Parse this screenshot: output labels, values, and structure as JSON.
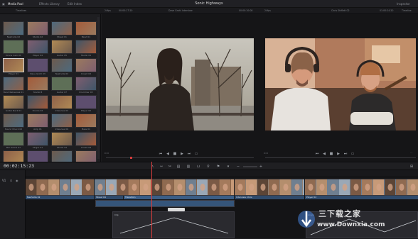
{
  "topbar": {
    "tabs": [
      {
        "label": "Media Pool",
        "active": true
      },
      {
        "label": "Effects Library",
        "active": false
      },
      {
        "label": "Edit Index",
        "active": false
      }
    ],
    "title": "Sonic Highways",
    "right_tab": "Inspector"
  },
  "subbar": {
    "left": "Timelines",
    "src_fps": "24fps",
    "src_tc": "00:00:17:20",
    "src_clip": "Dave Grohl Interview",
    "src_dur": "00:00:10:08",
    "rec_fps": "24fps",
    "rec_clip": "Chris Shiflett 02",
    "rec_tc": "01:00:24:20",
    "rec_zoom": "Timeline"
  },
  "media_pool": {
    "clips": [
      "Nashville 02",
      "Studio 02",
      "Street 01",
      "Band 01",
      "Drone Cam 01",
      "Player 04",
      "Guitar 05",
      "Studio 01",
      "Player 01",
      "Dave Grohl 03",
      "Nashville 02",
      "Crowd 02",
      "Band Rehearsal 01",
      "Studio B",
      "Guitar 07",
      "Drummer 03",
      "Guitar Neck 01",
      "Drums 02",
      "Interview 01",
      "Player 02",
      "Sound Check 02",
      "Amp 01",
      "Interview 04",
      "Bass 01",
      "Bar Scene 01",
      "Singer 01",
      "Studio 02",
      "Crowd 04",
      "Concert Lights",
      "Studio Dave",
      "Guitar 01",
      "Street 03"
    ]
  },
  "viewers": {
    "left_tc": "01:00:14:18",
    "right_tc": "01:00:24:20"
  },
  "timeline": {
    "timecode": "00:02:15:23",
    "track_label": "V1",
    "clips": [
      {
        "label": "Nashville 02"
      },
      {
        "label": "Street 04"
      },
      {
        "label": "Transition"
      },
      {
        "label": "Interview Chris"
      },
      {
        "label": "Player 02"
      }
    ],
    "curve_label": "Clip",
    "curve_label2": "Angle"
  },
  "watermark": {
    "text": "三下载之家",
    "url": "www.Downxia.com"
  },
  "colors": {
    "accent": "#d43c3c",
    "clip_blue": "#2f4a6b",
    "background": "#1b1b1e"
  }
}
